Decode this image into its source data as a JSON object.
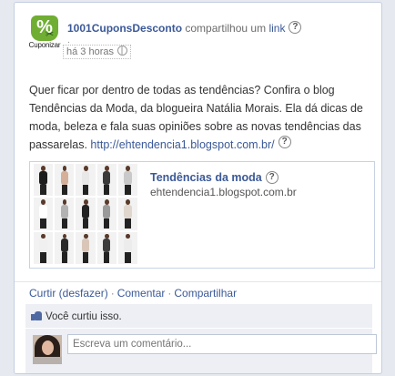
{
  "post": {
    "logo_text": "Cuponizar",
    "logo_symbol": "%",
    "author": "1001CuponsDesconto",
    "shared_text": "compartilhou um",
    "shared_link": "link",
    "help_glyph": "?",
    "dot": ".",
    "timestamp": "há 3 horas",
    "message": "Quer ficar por dentro de todas as tendências? Confira o blog Tendências da Moda, da blogueira Natália Morais. Ela dá dicas de moda, beleza e fala suas opiniões sobre as novas tendências das passarelas.",
    "message_url": "http://ehtendencia1.blogspot.com.br/"
  },
  "attachment": {
    "title": "Tendências da moda",
    "domain": "ehtendencia1.blogspot.com.br",
    "thumb_colors": [
      "#1c1c1c",
      "#d4b09a",
      "#e8e8e8",
      "#3a3a3a",
      "#c9c9c9",
      "#ffffff",
      "#b2b2b2",
      "#222222",
      "#9a9a9a",
      "#dfd6cd",
      "#f0f0f0",
      "#2a2a2a",
      "#d9c6b8",
      "#3d3d3d",
      "#ececec"
    ]
  },
  "actions": {
    "like": "Curtir (desfazer)",
    "comment": "Comentar",
    "share": "Compartilhar",
    "separator": "·"
  },
  "feedback": {
    "liked_text": "Você curtiu isso.",
    "comment_placeholder": "Escreva um comentário..."
  },
  "colors": {
    "link": "#3b5998",
    "feedback_bg": "#edeff4",
    "brand_green": "#6fae33"
  }
}
